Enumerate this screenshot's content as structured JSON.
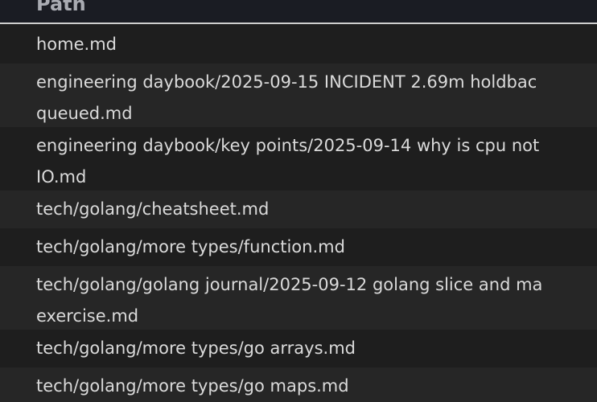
{
  "table": {
    "header": {
      "path_label": "Path"
    },
    "rows": [
      {
        "line1": "home.md",
        "line2": ""
      },
      {
        "line1": "engineering daybook/2025-09-15 INCIDENT 2.69m holdbac",
        "line2": "queued.md"
      },
      {
        "line1": "engineering daybook/key points/2025-09-14 why is cpu not",
        "line2": "IO.md"
      },
      {
        "line1": "tech/golang/cheatsheet.md",
        "line2": ""
      },
      {
        "line1": "tech/golang/more types/function.md",
        "line2": ""
      },
      {
        "line1": "tech/golang/golang journal/2025-09-12 golang slice and ma",
        "line2": "exercise.md"
      },
      {
        "line1": "tech/golang/more types/go arrays.md",
        "line2": ""
      },
      {
        "line1": "tech/golang/more types/go maps.md",
        "line2": ""
      }
    ]
  }
}
